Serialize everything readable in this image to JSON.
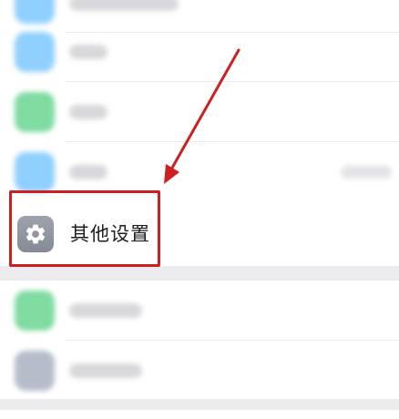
{
  "settings": {
    "highlighted_item": {
      "label": "其他设置",
      "icon": "gear-icon",
      "icon_bg": "#8e939e"
    },
    "blurred_items_above": [
      {
        "icon_color": "#8fd0ff"
      },
      {
        "icon_color": "#8fd0ff"
      },
      {
        "icon_color": "#7fdba0"
      },
      {
        "icon_color": "#8fd0ff"
      }
    ],
    "blurred_items_below": [
      {
        "icon_color": "#7fdba0"
      },
      {
        "icon_color": "#b7bccb"
      }
    ]
  },
  "annotation": {
    "color": "#cc2020"
  }
}
